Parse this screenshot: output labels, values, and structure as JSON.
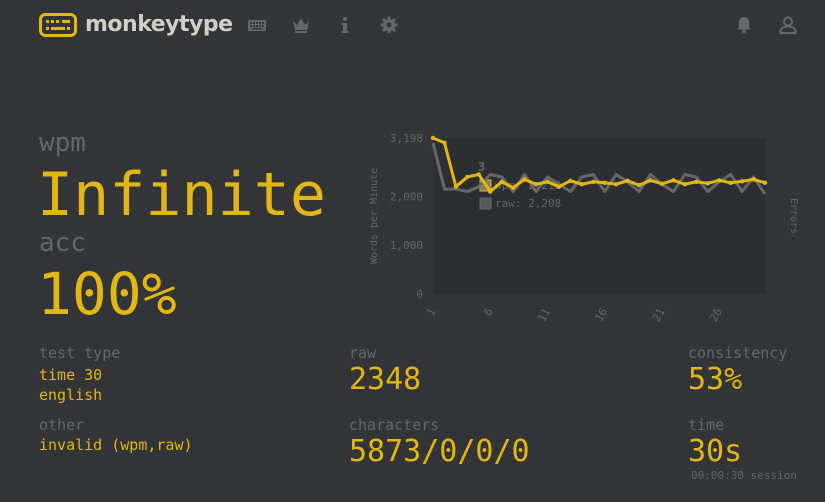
{
  "app": {
    "name": "monkeytype"
  },
  "nav": {
    "icons": [
      "keyboard-icon",
      "crown-icon",
      "info-icon",
      "gear-icon",
      "bell-icon",
      "user-icon"
    ]
  },
  "colors": {
    "bg": "#323437",
    "main": "#e2b714",
    "sub": "#646669",
    "text": "#d1d0c5"
  },
  "result": {
    "wpm_label": "wpm",
    "wpm_value": "Infinite",
    "acc_label": "acc",
    "acc_value": "100%",
    "test_type_label": "test type",
    "test_type_mode": "time 30",
    "test_type_language": "english",
    "other_label": "other",
    "other_value": "invalid (wpm,raw)",
    "raw_label": "raw",
    "raw_value": "2348",
    "characters_label": "characters",
    "characters_value": "5873/0/0/0",
    "consistency_label": "consistency",
    "consistency_value": "53%",
    "time_label": "time",
    "time_value": "30s",
    "session_time": "00:00:30 session"
  },
  "chart_data": {
    "type": "line",
    "ylabel": "Words per Minute",
    "y2label": "Errors",
    "ylim": [
      0,
      3198
    ],
    "y_ticks": [
      "3,198",
      "2,000",
      "1,000",
      "0"
    ],
    "x_ticks": [
      "1",
      "6",
      "11",
      "16",
      "21",
      "26"
    ],
    "x": [
      1,
      2,
      3,
      4,
      5,
      6,
      7,
      8,
      9,
      10,
      11,
      12,
      13,
      14,
      15,
      16,
      17,
      18,
      19,
      20,
      21,
      22,
      23,
      24,
      25,
      26,
      27,
      28,
      29,
      30
    ],
    "series": [
      {
        "name": "wpm",
        "color": "#e2b714",
        "values": [
          3198,
          3100,
          2200,
          2400,
          2450,
          2100,
          2300,
          2180,
          2350,
          2250,
          2300,
          2200,
          2320,
          2250,
          2300,
          2280,
          2250,
          2320,
          2230,
          2330,
          2260,
          2330,
          2250,
          2300,
          2270,
          2330,
          2280,
          2310,
          2350,
          2280
        ]
      },
      {
        "name": "raw",
        "color": "#646669",
        "values": [
          3100,
          2150,
          2150,
          2100,
          2200,
          2450,
          2400,
          2100,
          2450,
          2100,
          2400,
          2250,
          2100,
          2400,
          2450,
          2100,
          2450,
          2300,
          2100,
          2450,
          2250,
          2100,
          2450,
          2400,
          2100,
          2300,
          2450,
          2100,
          2400,
          2050
        ]
      }
    ],
    "tooltip": {
      "title": "3",
      "wpm": "wpm: 2,212",
      "raw": "raw: 2,208"
    }
  }
}
